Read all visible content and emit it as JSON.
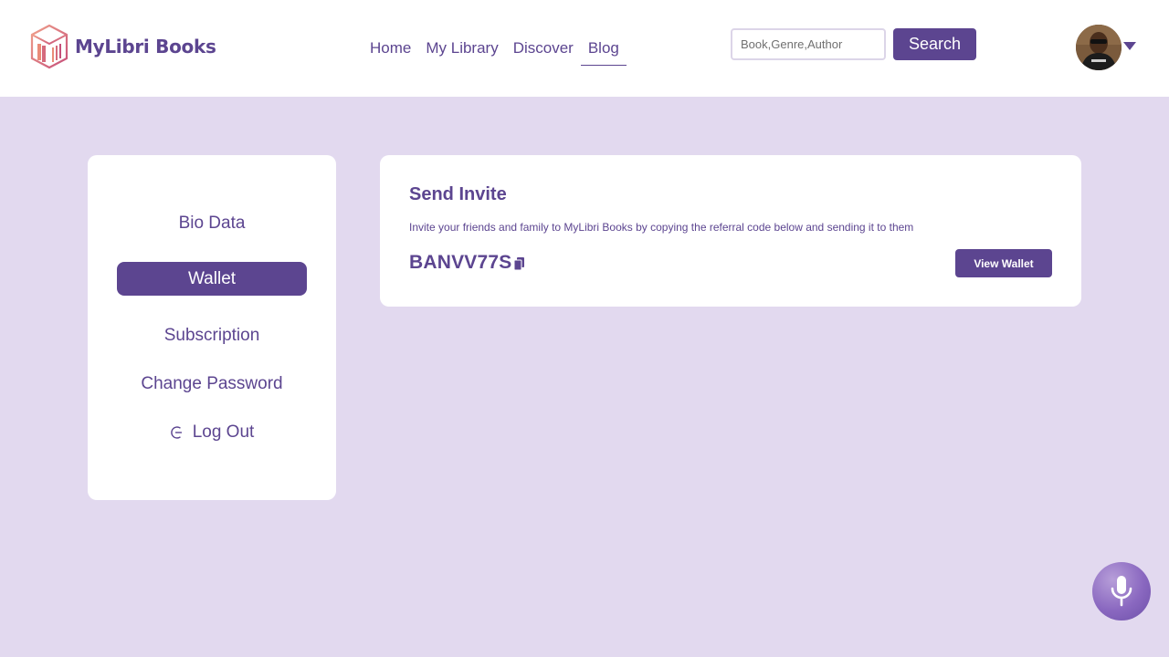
{
  "header": {
    "brand": "MyLibri Books",
    "nav": [
      {
        "label": "Home"
      },
      {
        "label": "My Library"
      },
      {
        "label": "Discover"
      },
      {
        "label": "Blog",
        "active": true
      }
    ],
    "search": {
      "placeholder": "Book,Genre,Author",
      "value": "",
      "button_label": "Search"
    },
    "avatar_icon": "user-avatar",
    "menu_icon": "caret-down-icon"
  },
  "sidebar": {
    "items": [
      {
        "label": "Bio Data"
      },
      {
        "label": "Wallet",
        "active": true
      },
      {
        "label": "Subscription"
      },
      {
        "label": "Change Password"
      },
      {
        "label": "Log Out",
        "icon": "logout-icon"
      }
    ]
  },
  "invite": {
    "title": "Send Invite",
    "description": "Invite your friends and family to MyLibri Books by copying the referral code below and sending it to them",
    "referral_code": "BANVV77S",
    "copy_icon": "copy-icon",
    "view_wallet_label": "View Wallet"
  },
  "mic": {
    "icon": "microphone-icon"
  },
  "colors": {
    "brand": "#5c4590",
    "background": "#e2d9ef",
    "card": "#ffffff",
    "logo_accent": "#e07a6e"
  }
}
